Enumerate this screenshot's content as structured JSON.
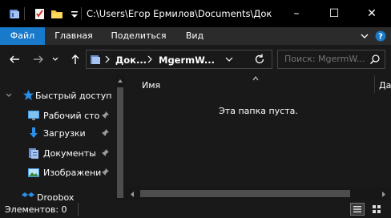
{
  "titlebar": {
    "title": "C:\\Users\\Егор Ермилов\\Documents\\Док...",
    "icons": [
      "folder-app-icon",
      "properties-icon",
      "new-folder-icon",
      "qat-dropdown-icon"
    ],
    "minimize": "–",
    "maximize": "☐",
    "close": "✕"
  },
  "ribbon": {
    "tabs": [
      {
        "label": "Файл",
        "active": true
      },
      {
        "label": "Главная",
        "active": false
      },
      {
        "label": "Поделиться",
        "active": false
      },
      {
        "label": "Вид",
        "active": false
      }
    ],
    "help": "?"
  },
  "address": {
    "segments": [
      "Док...",
      "MgermW..."
    ],
    "search_placeholder": "Поиск: MgermW..."
  },
  "nav": {
    "items": [
      {
        "label": "Быстрый доступ",
        "icon": "star-icon"
      },
      {
        "label": "Рабочий сто",
        "icon": "desktop-icon",
        "pinned": true
      },
      {
        "label": "Загрузки",
        "icon": "download-icon",
        "pinned": true
      },
      {
        "label": "Документы",
        "icon": "documents-icon",
        "pinned": true
      },
      {
        "label": "Изображени",
        "icon": "pictures-icon",
        "pinned": true
      },
      {
        "label": "Dropbox",
        "icon": "dropbox-icon"
      }
    ]
  },
  "content": {
    "column_name": "Имя",
    "column_next": "Да",
    "empty_text": "Эта папка пуста."
  },
  "status": {
    "text": "Элементов: 0"
  },
  "colors": {
    "accent": "#1979ca",
    "background": "#191919",
    "titlebar": "#000000",
    "ribbon": "#2b2b2b"
  }
}
